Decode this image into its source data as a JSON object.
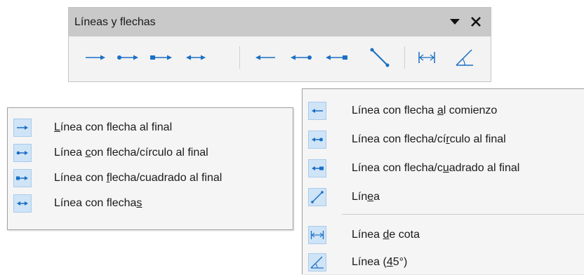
{
  "toolbar": {
    "title": "Líneas y flechas",
    "menu_icon": "dropdown-arrow-icon",
    "close_icon": "close-icon",
    "buttons": [
      {
        "icon": "line-ends-with-arrow-icon"
      },
      {
        "icon": "line-circle-arrow-icon"
      },
      {
        "icon": "line-square-arrow-icon"
      },
      {
        "icon": "line-with-arrows-icon"
      },
      {
        "icon": "line-starts-with-arrow-icon"
      },
      {
        "icon": "line-arrow-circle-icon"
      },
      {
        "icon": "line-arrow-square-icon"
      },
      {
        "icon": "line-icon"
      },
      {
        "icon": "dimension-line-icon"
      },
      {
        "icon": "line-45-icon"
      }
    ]
  },
  "menu_left": {
    "items": [
      {
        "pre": "",
        "u": "L",
        "post": "ínea con flecha al final",
        "icon": "line-ends-with-arrow-icon"
      },
      {
        "pre": "Línea ",
        "u": "c",
        "post": "on flecha/círculo al final",
        "icon": "line-circle-arrow-icon"
      },
      {
        "pre": "Línea con ",
        "u": "f",
        "post": "lecha/cuadrado al final",
        "icon": "line-square-arrow-icon"
      },
      {
        "pre": "Línea con flecha",
        "u": "s",
        "post": "",
        "icon": "line-with-arrows-icon"
      }
    ]
  },
  "menu_right": {
    "items": [
      {
        "pre": "Línea con flecha ",
        "u": "a",
        "post": "l comienzo",
        "icon": "line-starts-with-arrow-icon"
      },
      {
        "pre": "Línea con flecha/cí",
        "u": "r",
        "post": "culo al final",
        "icon": "line-arrow-circle-icon"
      },
      {
        "pre": "Línea con flecha/c",
        "u": "u",
        "post": "adrado al final",
        "icon": "line-arrow-square-icon"
      },
      {
        "pre": "Lín",
        "u": "e",
        "post": "a",
        "icon": "line-icon"
      },
      {
        "pre": "Línea ",
        "u": "d",
        "post": "e cota",
        "icon": "dimension-line-icon"
      },
      {
        "pre": "Línea (",
        "u": "4",
        "post": "5°)",
        "icon": "line-45-icon"
      }
    ]
  },
  "colors": {
    "icon_blue": "#1a6fc4",
    "icon_bg": "#cfe4f7",
    "title_bar": "#c9c9c9"
  }
}
